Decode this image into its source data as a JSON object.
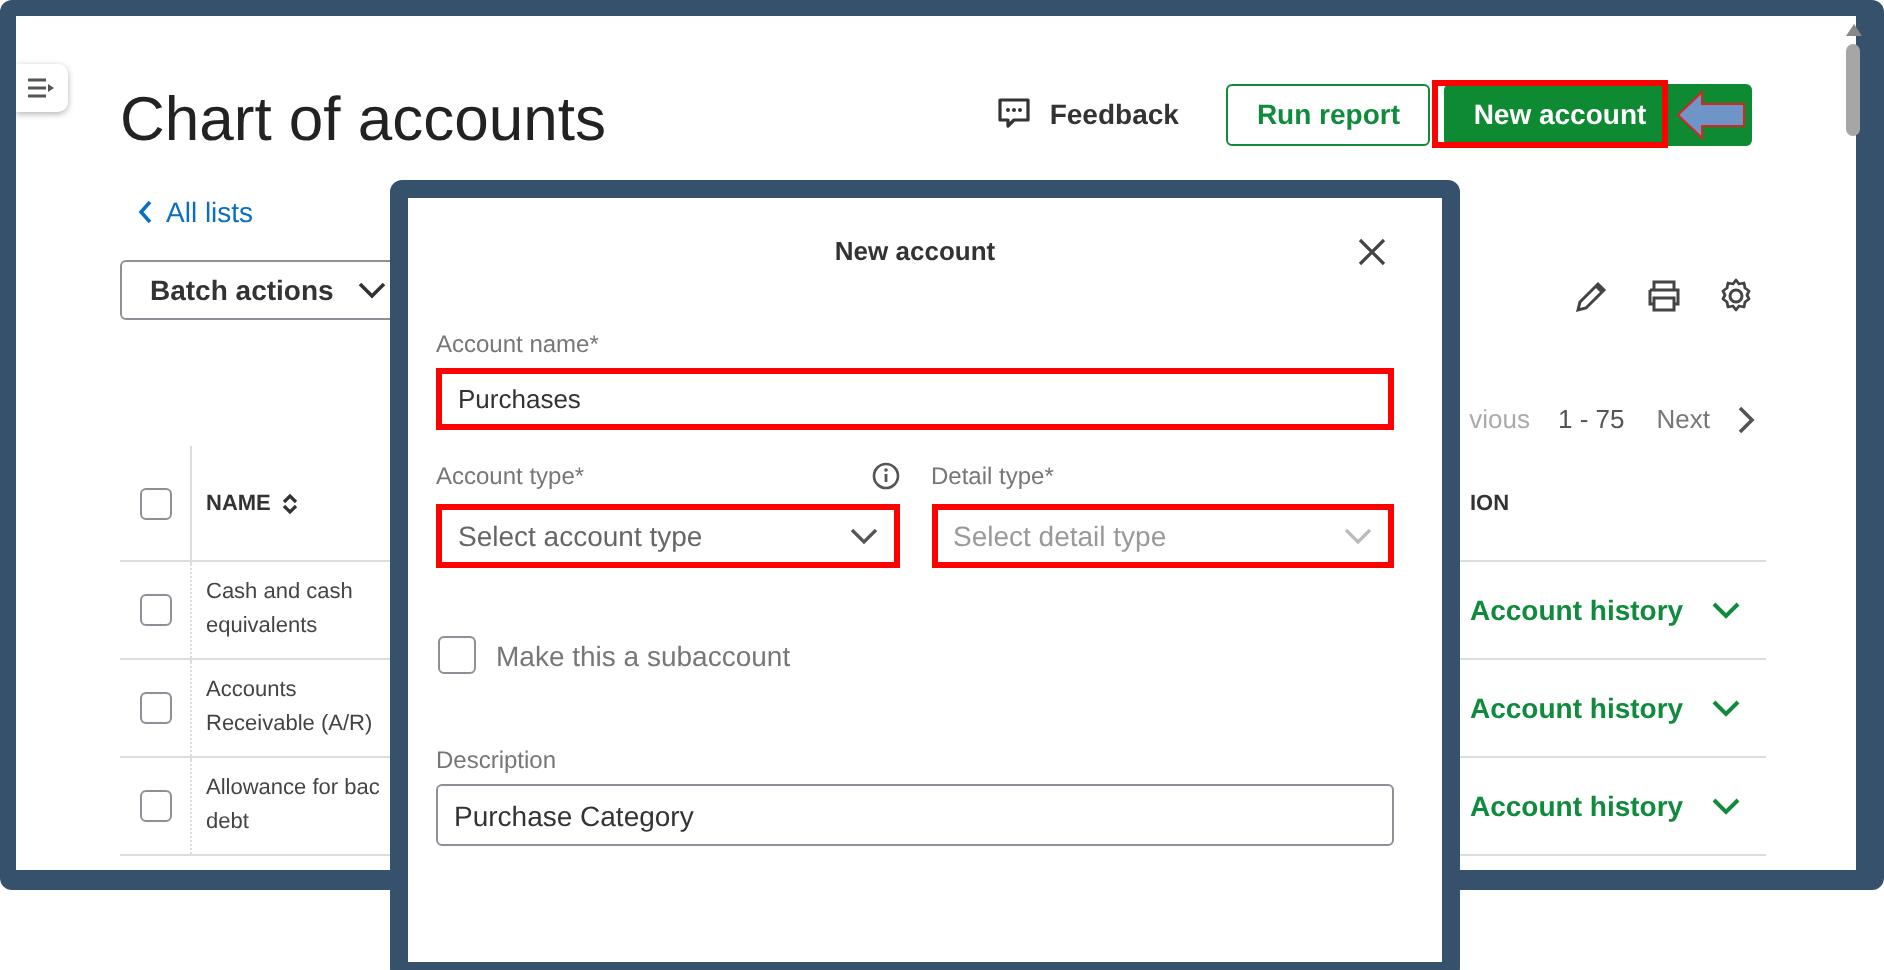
{
  "page": {
    "title": "Chart of accounts",
    "back_link": "All lists",
    "feedback": "Feedback",
    "run_report": "Run report",
    "new_account": {
      "label": "New account",
      "highlighted": true
    },
    "batch_actions": "Batch actions",
    "pagination": {
      "previous": "vious",
      "range": "1 - 75",
      "next": "Next"
    },
    "table": {
      "header_checked": false,
      "columns": [
        {
          "label": "NAME"
        },
        {
          "label": "ION"
        }
      ],
      "rows": [
        {
          "name": "Cash and cash\nequivalents",
          "checked": false,
          "action": "Account history"
        },
        {
          "name": "Accounts\nReceivable (A/R)",
          "checked": false,
          "action": "Account history"
        },
        {
          "name": "Allowance for bac\ndebt",
          "checked": false,
          "action": "Account history"
        }
      ]
    }
  },
  "modal": {
    "title": "New account",
    "account_name": {
      "label": "Account name*",
      "value": "Purchases",
      "highlighted": true
    },
    "account_type": {
      "label": "Account type*",
      "placeholder": "Select account type",
      "highlighted": true,
      "disabled": false
    },
    "detail_type": {
      "label": "Detail type*",
      "placeholder": "Select detail type",
      "highlighted": true,
      "disabled": true
    },
    "subaccount": {
      "label": "Make this a subaccount",
      "checked": false
    },
    "description": {
      "label": "Description",
      "value": "Purchase Category",
      "highlighted": false
    }
  }
}
